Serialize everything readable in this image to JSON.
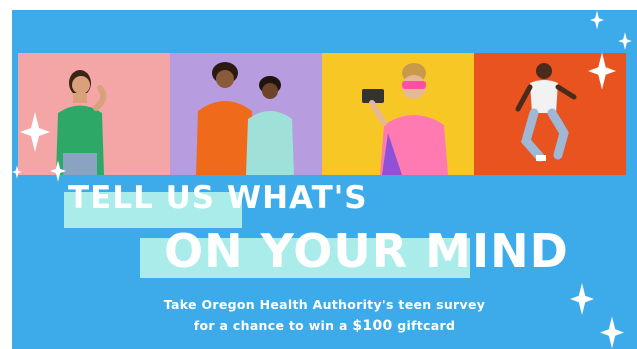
{
  "headline": {
    "line1": "TELL US WHAT'S",
    "line2": "ON YOUR MIND"
  },
  "subtext": {
    "line1": "Take Oregon Health Authority's teen survey",
    "line2_prefix": "for a chance to win a ",
    "line2_amount": "$100",
    "line2_suffix": " giftcard"
  },
  "colors": {
    "background": "#3dabea",
    "highlight": "#a9ecea",
    "text": "#ffffff",
    "photo_1_bg": "#f4a6a6",
    "photo_2_bg": "#b89ce0",
    "photo_3_bg": "#f7c825",
    "photo_4_bg": "#e8531f"
  },
  "photos": [
    {
      "name": "teen-in-green-shirt"
    },
    {
      "name": "two-teens-orange-and-teal-hoodies"
    },
    {
      "name": "teen-holding-phone-in-pink-glasses"
    },
    {
      "name": "teen-jumping"
    }
  ]
}
